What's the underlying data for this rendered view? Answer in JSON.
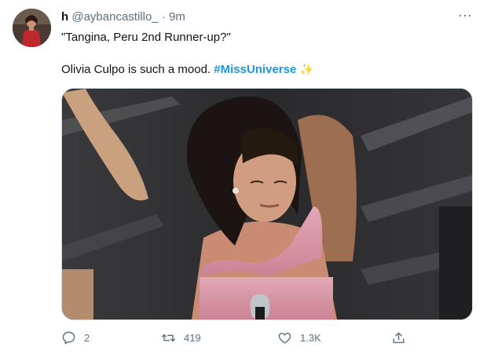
{
  "tweet": {
    "display_name": "h",
    "handle": "@aybancastillo_",
    "separator": "·",
    "time": "9m",
    "more_label": "···",
    "line1": "\"Tangina, Peru 2nd Runner-up?\"",
    "line2_prefix": "Olivia Culpo is such a mood. ",
    "hashtag": "#MissUniverse",
    "emoji": "✨",
    "accent_color": "#1b95e0"
  },
  "actions": {
    "reply_count": "2",
    "retweet_count": "419",
    "like_count": "1.3K"
  },
  "icons": [
    "more-icon",
    "reply-icon",
    "retweet-icon",
    "like-icon",
    "share-icon"
  ]
}
